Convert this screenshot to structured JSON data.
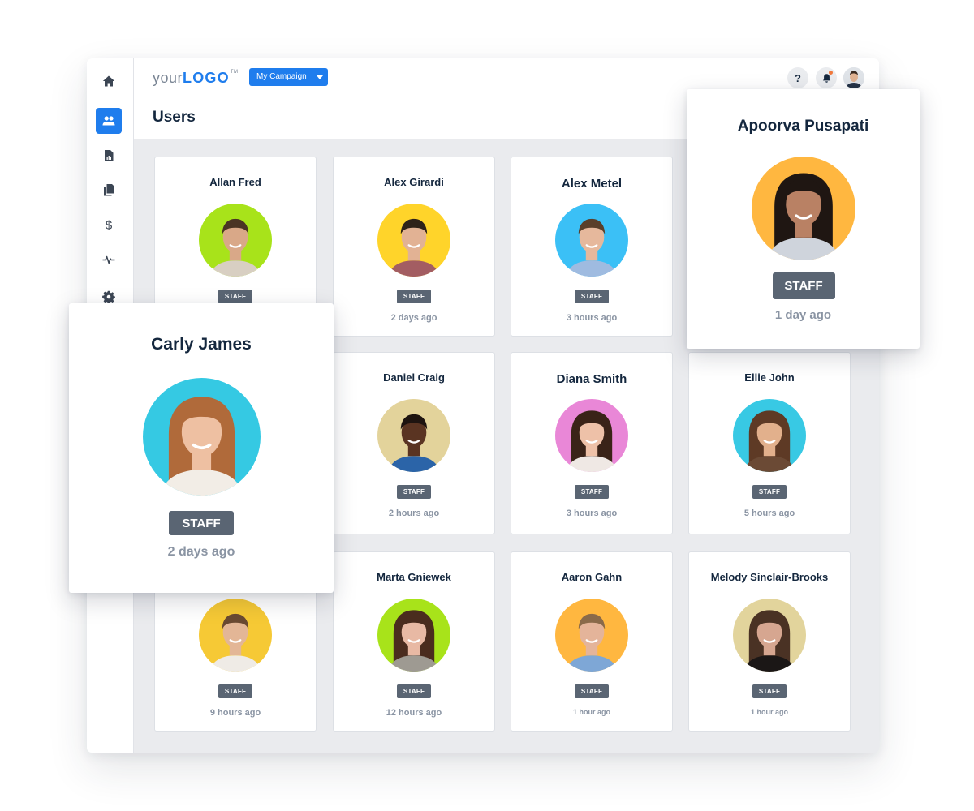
{
  "app": {
    "logo_prefix": "your",
    "logo_brand": "LOGO",
    "logo_tm": "TM",
    "campaign_selector": "My Campaign",
    "help_icon_glyph": "?",
    "page_title": "Users"
  },
  "sidebar": {
    "items": [
      {
        "name": "home",
        "icon": "home-icon",
        "active": false
      },
      {
        "name": "users",
        "icon": "users-icon",
        "active": true
      },
      {
        "name": "reports",
        "icon": "report-icon",
        "active": false
      },
      {
        "name": "documents",
        "icon": "copy-icon",
        "active": false
      },
      {
        "name": "billing",
        "icon": "dollar-icon",
        "active": false
      },
      {
        "name": "activity",
        "icon": "pulse-icon",
        "active": false
      },
      {
        "name": "settings",
        "icon": "gear-icon",
        "active": false
      }
    ]
  },
  "colors": {
    "accent": "#1f7ded",
    "badge": "#5a6573",
    "notification": "#f0783c"
  },
  "users": [
    {
      "name": "Allan Fred",
      "role": "STAFF",
      "last_seen": "",
      "avatar_bg": "#a8e31a",
      "skin": "#d9a888",
      "hair": "#4a3424",
      "shirt": "#d8cfc2"
    },
    {
      "name": "Alex Girardi",
      "role": "STAFF",
      "last_seen": "2 days ago",
      "avatar_bg": "#ffd42a",
      "skin": "#e2b294",
      "hair": "#2e2219",
      "shirt": "#a35d62"
    },
    {
      "name": "Alex Metel",
      "role": "STAFF",
      "last_seen": "3 hours ago",
      "avatar_bg": "#3bc0f6",
      "skin": "#e6b89c",
      "hair": "#5a3f2a",
      "shirt": "#9fbbe0"
    },
    {
      "name": "Daniel Craig",
      "role": "STAFF",
      "last_seen": "2 hours ago",
      "avatar_bg": "#e3d39b",
      "skin": "#5a3422",
      "hair": "#1e1410",
      "shirt": "#2b64a8"
    },
    {
      "name": "Diana Smith",
      "role": "STAFF",
      "last_seen": "3 hours ago",
      "avatar_bg": "#e987d7",
      "skin": "#eec1a8",
      "hair": "#3a2318",
      "shirt": "#efe8e4"
    },
    {
      "name": "Ellie John",
      "role": "STAFF",
      "last_seen": "5 hours ago",
      "avatar_bg": "#38c9e4",
      "skin": "#e2b08c",
      "hair": "#5e3a25",
      "shirt": "#6b4a35"
    },
    {
      "name": "",
      "role": "STAFF",
      "last_seen": "9 hours ago",
      "avatar_bg": "#f6c935",
      "skin": "#e3b696",
      "hair": "#6a4a32",
      "shirt": "#efebe6"
    },
    {
      "name": "Marta Gniewek",
      "role": "STAFF",
      "last_seen": "12 hours ago",
      "avatar_bg": "#a8e31a",
      "skin": "#e8b9a4",
      "hair": "#4a2c1e",
      "shirt": "#9e9a92"
    },
    {
      "name": "Aaron Gahn",
      "role": "STAFF",
      "last_seen": "1 hour ago",
      "avatar_bg": "#ffb740",
      "skin": "#e4b49a",
      "hair": "#8a6a4a",
      "shirt": "#7ea7d6"
    },
    {
      "name": "Melody Sinclair-Brooks",
      "role": "STAFF",
      "last_seen": "1 hour ago",
      "avatar_bg": "#e2d49c",
      "skin": "#d6a690",
      "hair": "#4a3224",
      "shirt": "#1b1716"
    }
  ],
  "popouts": {
    "apoorva": {
      "name": "Apoorva Pusapati",
      "role": "STAFF",
      "last_seen": "1 day ago",
      "avatar_bg": "#ffb740",
      "skin": "#b98164",
      "hair": "#1f1612",
      "shirt": "#cfd4dc"
    },
    "carly": {
      "name": "Carly James",
      "role": "STAFF",
      "last_seen": "2 days ago",
      "avatar_bg": "#35c9e3",
      "skin": "#eec0a2",
      "hair": "#b06a3a",
      "shirt": "#f2ede6"
    }
  }
}
